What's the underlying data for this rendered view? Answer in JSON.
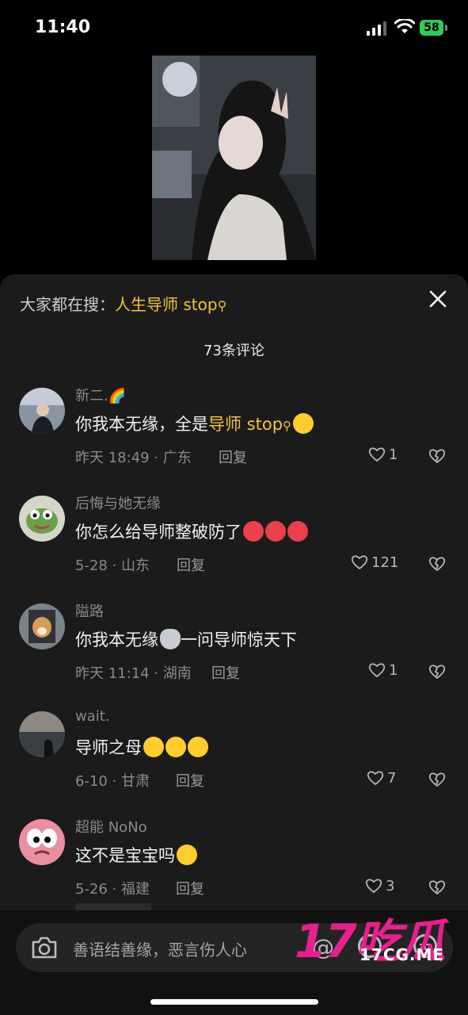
{
  "status_bar": {
    "time": "11:40",
    "battery": "58"
  },
  "search_suggest": {
    "prefix": "大家都在搜：",
    "keyword": "人生导师 stop"
  },
  "comment_count": "73条评论",
  "comments": [
    {
      "user": "新二.",
      "user_emoji": "🌈",
      "text_before": "你我本无缘，全是",
      "highlight": "导师 stop",
      "text_after": "",
      "emojis": [
        "cry"
      ],
      "meta": "昨天 18:49 · 广东",
      "reply": "回复",
      "likes": "1"
    },
    {
      "user": "后悔与她无缘",
      "text_before": "你怎么给导师整破防了",
      "highlight": "",
      "text_after": "",
      "emojis": [
        "angry",
        "angry",
        "angry"
      ],
      "meta": "5-28 · 山东",
      "reply": "回复",
      "likes": "121"
    },
    {
      "user": "隘路",
      "text_before": "你我本无缘",
      "highlight": "",
      "text_after": "一问导师惊天下",
      "emojis_mid": [
        "cat"
      ],
      "meta": "昨天 11:14 · 湖南",
      "reply": "回复",
      "likes": "1"
    },
    {
      "user": "wait.",
      "text_before": "导师之母",
      "highlight": "",
      "text_after": "",
      "emojis": [
        "cry",
        "cry",
        "cry"
      ],
      "meta": "6-10 · 甘肃",
      "reply": "回复",
      "likes": "7"
    },
    {
      "user": "超能 NoNo",
      "text_before": "这不是宝宝吗",
      "highlight": "",
      "text_after": "",
      "emojis": [
        "cry"
      ],
      "meta": "5-26 · 福建",
      "reply": "回复",
      "likes": "3"
    }
  ],
  "input": {
    "placeholder": "善语结善缘，恶言伤人心"
  },
  "watermark": {
    "big": "17吃瓜",
    "small": "17CG.ME"
  },
  "colors": {
    "accent": "#f5c33b",
    "sheet": "#1b1b1b",
    "watermark": "#e8208f"
  }
}
